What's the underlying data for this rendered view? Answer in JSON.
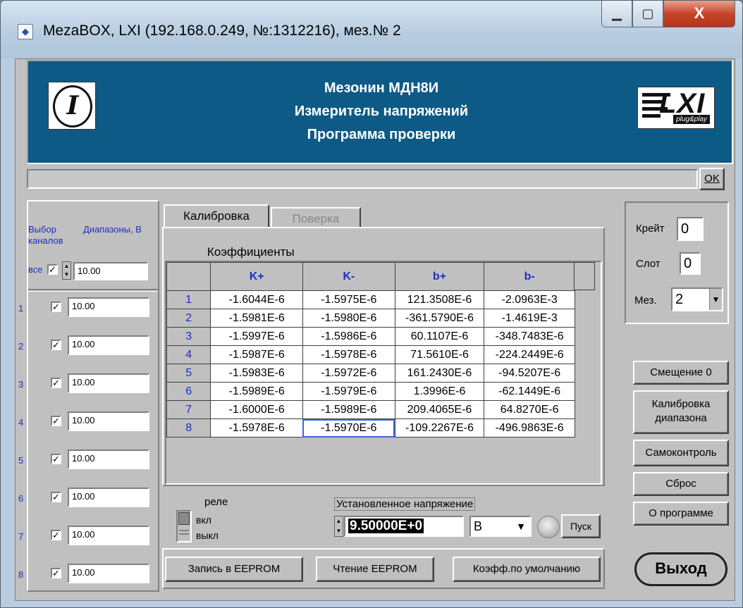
{
  "window": {
    "title": "MezaBOX, LXI (192.168.0.249, №:1312216), мез.№ 2",
    "icon": "app-diamond-icon",
    "controls": {
      "minimize": "minimize-icon",
      "maximize": "maximize-icon",
      "close": "X"
    }
  },
  "banner": {
    "line1": "Мезонин МДН8И",
    "line2": "Измеритель напряжений",
    "line3": "Программа проверки",
    "logo_left_text": "I",
    "logo_right_text": "LXI",
    "logo_right_sub": "plug&play",
    "bg_color": "#0e5a86"
  },
  "status": {
    "text": "",
    "ok_label": "OK"
  },
  "channels": {
    "header_select": "Выбор каналов",
    "header_range": "Диапазоны, В",
    "all_label": "все",
    "all_checked": true,
    "all_value": "10.00",
    "items": [
      {
        "num": "1",
        "checked": true,
        "value": "10.00"
      },
      {
        "num": "2",
        "checked": true,
        "value": "10.00"
      },
      {
        "num": "3",
        "checked": true,
        "value": "10.00"
      },
      {
        "num": "4",
        "checked": true,
        "value": "10.00"
      },
      {
        "num": "5",
        "checked": true,
        "value": "10.00"
      },
      {
        "num": "6",
        "checked": true,
        "value": "10.00"
      },
      {
        "num": "7",
        "checked": true,
        "value": "10.00"
      },
      {
        "num": "8",
        "checked": true,
        "value": "10.00"
      }
    ]
  },
  "tabs": [
    {
      "label": "Калибровка",
      "active": true
    },
    {
      "label": "Поверка",
      "active": false
    }
  ],
  "coefficients": {
    "title": "Коэффициенты",
    "columns": [
      "K+",
      "K-",
      "b+",
      "b-"
    ],
    "rows": [
      {
        "num": "1",
        "values": [
          "-1.6044E-6",
          "-1.5975E-6",
          "121.3508E-6",
          "-2.0963E-3"
        ]
      },
      {
        "num": "2",
        "values": [
          "-1.5981E-6",
          "-1.5980E-6",
          "-361.5790E-6",
          "-1.4619E-3"
        ]
      },
      {
        "num": "3",
        "values": [
          "-1.5997E-6",
          "-1.5986E-6",
          "60.1107E-6",
          "-348.7483E-6"
        ]
      },
      {
        "num": "4",
        "values": [
          "-1.5987E-6",
          "-1.5978E-6",
          "71.5610E-6",
          "-224.2449E-6"
        ]
      },
      {
        "num": "5",
        "values": [
          "-1.5983E-6",
          "-1.5972E-6",
          "161.2430E-6",
          "-94.5207E-6"
        ]
      },
      {
        "num": "6",
        "values": [
          "-1.5989E-6",
          "-1.5979E-6",
          "1.3996E-6",
          "-62.1449E-6"
        ]
      },
      {
        "num": "7",
        "values": [
          "-1.6000E-6",
          "-1.5989E-6",
          "209.4065E-6",
          "64.8270E-6"
        ]
      },
      {
        "num": "8",
        "values": [
          "-1.5978E-6",
          "-1.5970E-6",
          "-109.2267E-6",
          "-496.9863E-6"
        ]
      }
    ]
  },
  "relay": {
    "title": "реле",
    "on_label": "вкл",
    "off_label": "выкл"
  },
  "voltage": {
    "label": "Установленное напряжение",
    "value": "9.50000E+0",
    "unit": "В",
    "start_label": "Пуск"
  },
  "eeprom": {
    "write_label": "Запись в EEPROM",
    "read_label": "Чтение EEPROM",
    "default_label": "Коэфф.по умолчанию"
  },
  "location": {
    "crate_label": "Крейт",
    "crate_value": "0",
    "slot_label": "Слот",
    "slot_value": "0",
    "mez_label": "Мез.",
    "mez_value": "2"
  },
  "actions": {
    "offset_label": "Смещение 0",
    "range_cal_label": "Калибровка диапазона",
    "selftest_label": "Самоконтроль",
    "reset_label": "Сброс",
    "about_label": "О программе",
    "exit_label": "Выход"
  }
}
